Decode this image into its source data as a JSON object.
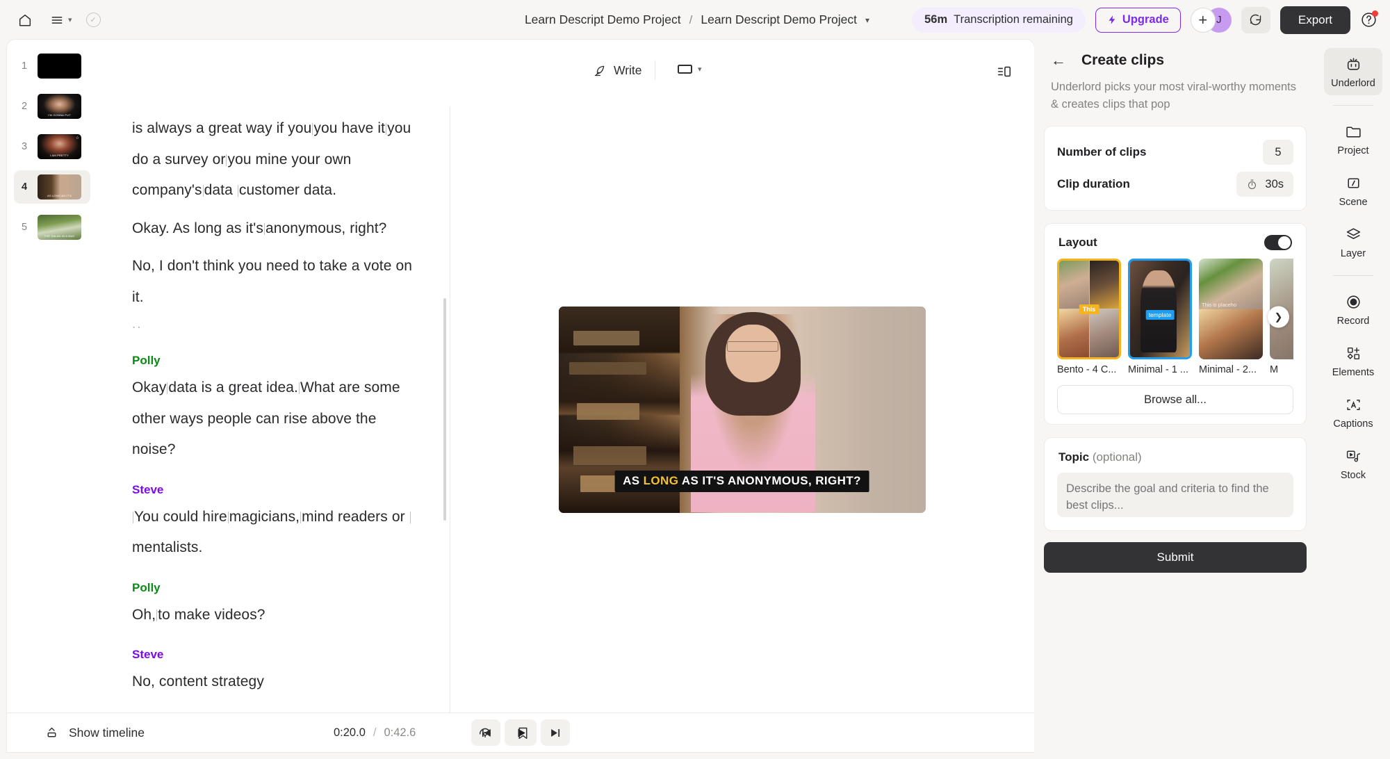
{
  "topbar": {
    "home_icon": "home-icon",
    "menu_icon": "hamburger-menu-icon",
    "check_icon": "check-circle-icon",
    "breadcrumb": {
      "parent": "Learn Descript Demo Project",
      "separator": "/",
      "current": "Learn Descript Demo Project"
    },
    "transcription": {
      "minutes": "56m",
      "label": "Transcription remaining"
    },
    "upgrade_label": "Upgrade",
    "avatar_initial": "J",
    "add_icon": "plus-icon",
    "comment_icon": "comment-bubble-icon",
    "export_label": "Export",
    "help_icon": "question-mark-circle-icon",
    "accent_purple": "#7d2ae8"
  },
  "scenes": [
    {
      "number": "1",
      "caption": ""
    },
    {
      "number": "2",
      "caption": "I'M GONNA PUT"
    },
    {
      "number": "3",
      "caption": "I AM PRETTY",
      "starred": true
    },
    {
      "number": "4",
      "caption": "AS LONG AS IT'S",
      "active": true
    },
    {
      "number": "5",
      "caption": "THE SALAD IN A BAG"
    }
  ],
  "preview_header": {
    "write_label": "Write",
    "write_icon": "feather-pen-icon",
    "aspect_icon": "aspect-ratio-icon",
    "aspect_chevron": "chevron-down-icon",
    "panel_toggle_icon": "side-panel-toggle-icon"
  },
  "transcript": {
    "blocks": [
      {
        "type": "text",
        "lines": [
          "is always a great way if you|you have it|you do a",
          "survey or|you mine your own company's|data",
          "|customer data."
        ]
      },
      {
        "type": "text",
        "lines": [
          "Okay. As long as it's|anonymous, right?"
        ]
      },
      {
        "type": "text",
        "lines": [
          "No, I don't think you need to take a vote on it."
        ]
      },
      {
        "type": "ellipsis",
        "text": ".."
      },
      {
        "type": "speaker",
        "name": "Polly",
        "color": "#0a8a16"
      },
      {
        "type": "text",
        "lines": [
          "Okay|data is a great idea.|What are some other",
          "ways people can rise above the noise?"
        ]
      },
      {
        "type": "speaker",
        "name": "Steve",
        "color": "#7d0ae8"
      },
      {
        "type": "text",
        "lines": [
          "|You could hire|magicians,|mind readers or",
          "|mentalists."
        ]
      },
      {
        "type": "speaker",
        "name": "Polly",
        "color": "#0a8a16"
      },
      {
        "type": "text",
        "lines": [
          "Oh,|to make videos?"
        ]
      },
      {
        "type": "speaker",
        "name": "Steve",
        "color": "#7d0ae8"
      },
      {
        "type": "text",
        "lines": [
          "No, content strategy"
        ]
      }
    ]
  },
  "video": {
    "caption_before": "AS ",
    "caption_highlight": "LONG",
    "caption_after": " AS IT'S ANONYMOUS, RIGHT?",
    "highlight_color": "#f6c32b"
  },
  "bottombar": {
    "show_timeline_label": "Show timeline",
    "show_timeline_icon": "panel-up-icon",
    "current_time": "0:20.0",
    "time_separator": "/",
    "total_time": "0:42.6",
    "prev_icon": "skip-previous-icon",
    "play_icon": "play-icon",
    "next_icon": "skip-next-icon",
    "loop_icon": "loop-speed-icon",
    "bookmark_icon": "bookmark-icon"
  },
  "right_panel": {
    "back_icon": "back-arrow-icon",
    "title": "Create clips",
    "subtitle": "Underlord picks your most viral-worthy moments & creates clips that pop",
    "settings": [
      {
        "label": "Number of clips",
        "value": "5",
        "icon": null
      },
      {
        "label": "Clip duration",
        "value": "30s",
        "icon": "stopwatch-icon"
      }
    ],
    "layout": {
      "label": "Layout",
      "toggle_on": true,
      "items": [
        {
          "name": "Bento - 4 C...",
          "badge": "This",
          "selection": "gold"
        },
        {
          "name": "Minimal - 1 ...",
          "badge": "template",
          "selection": "blue"
        },
        {
          "name": "Minimal - 2...",
          "badge": "This is placeho",
          "selection": "none"
        },
        {
          "name": "M",
          "badge": "",
          "selection": "none"
        }
      ],
      "next_icon": "chevron-right-icon",
      "browse_label": "Browse all..."
    },
    "topic": {
      "label": "Topic",
      "optional": "(optional)",
      "placeholder": "Describe the goal and criteria to find the best clips..."
    },
    "submit_label": "Submit"
  },
  "tool_rail": [
    {
      "label": "Underlord",
      "icon": "robot-icon",
      "active": true
    },
    {
      "label": "Project",
      "icon": "folder-icon",
      "active": false
    },
    {
      "label": "Scene",
      "icon": "scene-slash-icon",
      "active": false
    },
    {
      "label": "Layer",
      "icon": "layers-icon",
      "active": false
    },
    {
      "label": "Record",
      "icon": "record-dot-icon",
      "active": false
    },
    {
      "label": "Elements",
      "icon": "elements-shapes-icon",
      "active": false
    },
    {
      "label": "Captions",
      "icon": "captions-a-icon",
      "active": false
    },
    {
      "label": "Stock",
      "icon": "stock-media-icon",
      "active": false
    }
  ]
}
